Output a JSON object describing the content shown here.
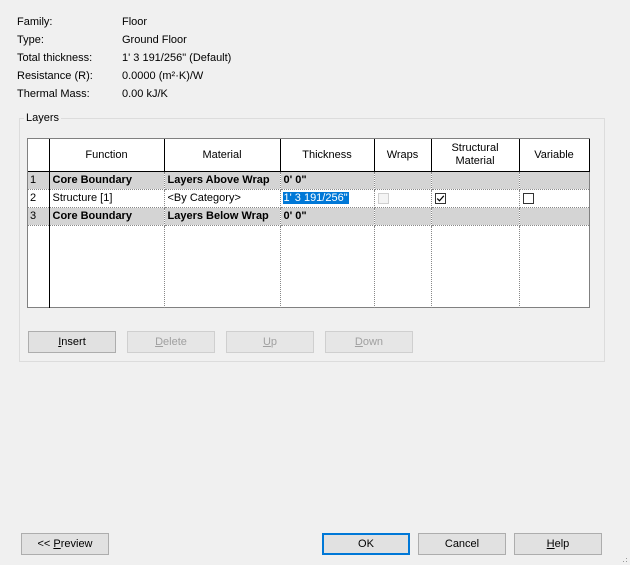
{
  "properties": {
    "family_label": "Family:",
    "family_value": "Floor",
    "type_label": "Type:",
    "type_value": "Ground Floor",
    "thickness_label": "Total thickness:",
    "thickness_value": "1'  3 191/256\" (Default)",
    "resistance_label": "Resistance (R):",
    "resistance_value": "0.0000 (m²·K)/W",
    "mass_label": "Thermal Mass:",
    "mass_value": "0.00 kJ/K"
  },
  "layers": {
    "group_title": "Layers",
    "columns": {
      "num": "",
      "function": "Function",
      "material": "Material",
      "thickness": "Thickness",
      "wraps": "Wraps",
      "structural_line1": "Structural",
      "structural_line2": "Material",
      "variable": "Variable"
    },
    "rows": [
      {
        "num": "1",
        "function": "Core Boundary",
        "material": "Layers Above Wrap",
        "thickness": "0'  0\"",
        "wraps": null,
        "structural": null,
        "variable": null
      },
      {
        "num": "2",
        "function": "Structure [1]",
        "material": "<By Category>",
        "thickness": "1'  3 191/256\"",
        "wraps": false,
        "structural": true,
        "variable": false
      },
      {
        "num": "3",
        "function": "Core Boundary",
        "material": "Layers Below Wrap",
        "thickness": "0'  0\"",
        "wraps": null,
        "structural": null,
        "variable": null
      }
    ]
  },
  "buttons": {
    "insert": {
      "mnemonic": "I",
      "rest": "nsert"
    },
    "delete": {
      "mnemonic": "D",
      "rest": "elete"
    },
    "up": {
      "mnemonic": "U",
      "rest": "p"
    },
    "down": {
      "mnemonic": "D",
      "rest": "own"
    },
    "preview": {
      "prefix": "<< ",
      "mnemonic": "P",
      "rest": "review"
    },
    "ok": "OK",
    "cancel": "Cancel",
    "help": {
      "mnemonic": "H",
      "rest": "elp"
    }
  },
  "colors": {
    "selection": "#0078d7",
    "core_row": "#d4d4d4",
    "default_button_border": "#0078d7"
  }
}
